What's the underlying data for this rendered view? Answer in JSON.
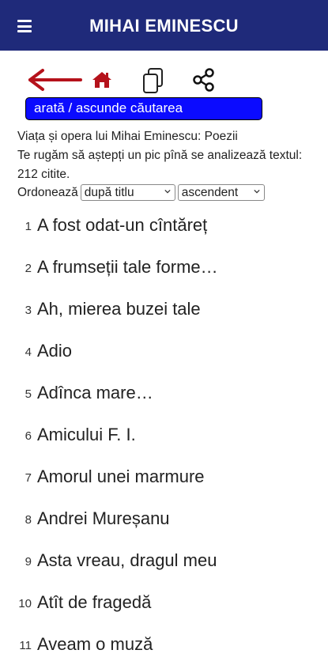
{
  "header": {
    "title": "MIHAI EMINESCU"
  },
  "icons": {
    "menu": "hamburger-menu-icon",
    "back": "back-arrow-icon",
    "home": "home-icon",
    "copy": "copy-icon",
    "share": "share-icon"
  },
  "colors": {
    "header_bg": "#1f2a7a",
    "accent_red": "#b5121b",
    "search_btn": "#0b0bff"
  },
  "search_toggle": {
    "label": "arată / ascunde căutarea"
  },
  "info": {
    "line1": "Viața și opera lui Mihai Eminescu: Poezii",
    "line2": "Te rugăm să aștepți un pic pînă se analizează textul: 212 citite."
  },
  "sort": {
    "label": "Ordonează",
    "by_selected": "după titlu",
    "order_selected": "ascendent"
  },
  "poems": [
    {
      "n": "1",
      "title": "A fost odat-un cîntăreț"
    },
    {
      "n": "2",
      "title": "A frumseții tale forme…"
    },
    {
      "n": "3",
      "title": "Ah, mierea buzei tale"
    },
    {
      "n": "4",
      "title": "Adio"
    },
    {
      "n": "5",
      "title": "Adînca mare…"
    },
    {
      "n": "6",
      "title": "Amicului F. I."
    },
    {
      "n": "7",
      "title": "Amorul unei marmure"
    },
    {
      "n": "8",
      "title": "Andrei Mureșanu"
    },
    {
      "n": "9",
      "title": "Asta vreau, dragul meu"
    },
    {
      "n": "10",
      "title": "Atît de fragedă"
    },
    {
      "n": "11",
      "title": "Aveam o muză"
    }
  ]
}
